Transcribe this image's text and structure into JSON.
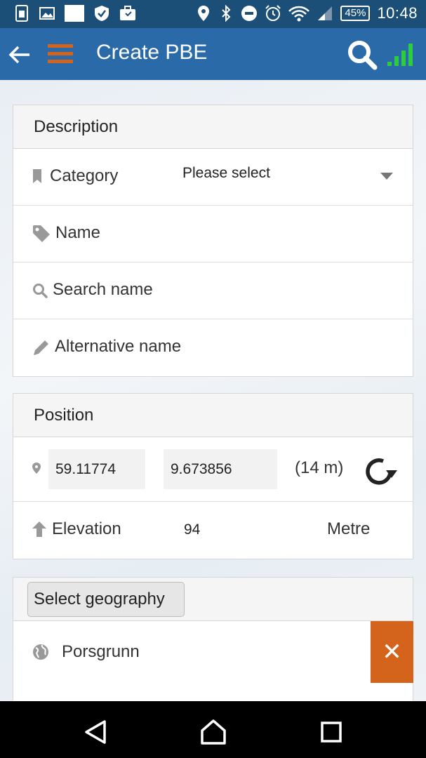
{
  "status_bar": {
    "battery": "45%",
    "time": "10:48",
    "icons": [
      "sim-card-icon",
      "image-icon",
      "white-square-icon",
      "shield-check-icon",
      "briefcase-icon",
      "location-icon",
      "bluetooth-icon",
      "do-not-disturb-icon",
      "alarm-icon",
      "wifi-icon",
      "cell-signal-icon"
    ]
  },
  "app_bar": {
    "title": "Create PBE",
    "signal_color": "#2ecc40"
  },
  "description": {
    "header": "Description",
    "category_label": "Category",
    "category_value": "Please select",
    "name_label": "Name",
    "search_name_label": "Search name",
    "alternative_name_label": "Alternative name"
  },
  "position": {
    "header": "Position",
    "latitude": "59.11774",
    "longitude": "9.673856",
    "accuracy": "(14 m)",
    "elevation_label": "Elevation",
    "elevation_value": "94",
    "elevation_unit": "Metre"
  },
  "geography": {
    "button_label": "Select geography",
    "selected": "Porsgrunn",
    "remove_label": "✕"
  },
  "colors": {
    "app_bar": "#2a6aa8",
    "status_bar": "#1b4f78",
    "menu_icon": "#d4631c",
    "remove_button": "#d4631c"
  }
}
